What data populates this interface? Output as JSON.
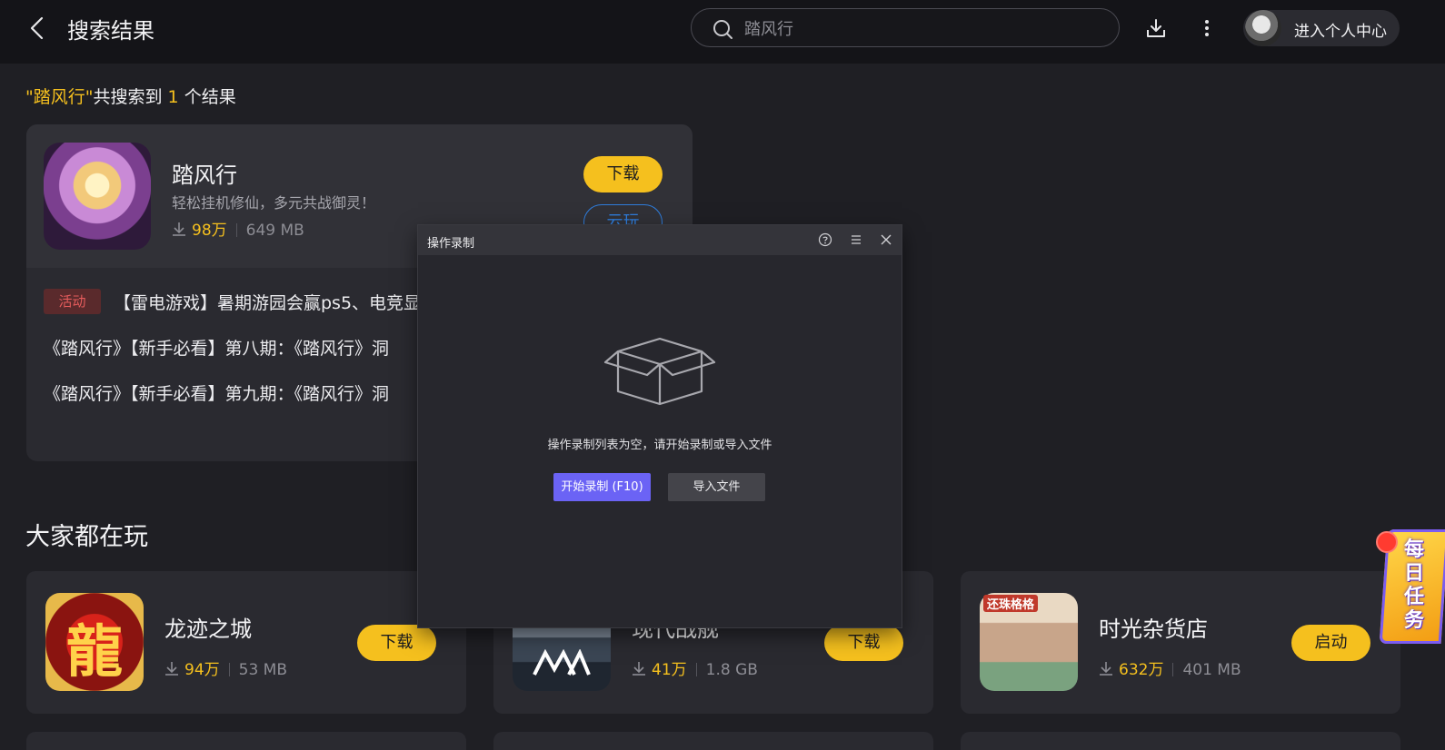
{
  "header": {
    "title": "搜索结果",
    "search_value": "踏风行",
    "user_label": "进入个人中心"
  },
  "result_summary": {
    "query_quoted": "\"踏风行\"",
    "middle": "共搜索到",
    "count": "1",
    "suffix": "个结果"
  },
  "main_result": {
    "name": "踏风行",
    "description": "轻松挂机修仙，多元共战御灵！",
    "downloads": "98万",
    "size": "649 MB",
    "download_label": "下载",
    "cloud_label": "云玩",
    "activity_tag": "活动",
    "news": [
      "【雷电游戏】暑期游园会赢ps5、电竞显",
      "《踏风行》【新手必看】第八期：《踏风行》洞",
      "《踏风行》【新手必看】第九期：《踏风行》洞"
    ]
  },
  "section_title": "大家都在玩",
  "popular": [
    {
      "name": "龙迹之城",
      "downloads": "94万",
      "size": "53 MB",
      "action": "下载",
      "icon_text": "龍"
    },
    {
      "name": "现代战舰",
      "downloads": "41万",
      "size": "1.8 GB",
      "action": "下载"
    },
    {
      "name": "时光杂货店",
      "downloads": "632万",
      "size": "401 MB",
      "action": "启动",
      "icon_text": "还珠格格"
    }
  ],
  "dialog": {
    "title": "操作录制",
    "empty_message": "操作录制列表为空，请开始录制或导入文件",
    "record_label": "开始录制 (F10)",
    "import_label": "导入文件"
  },
  "daily_task": {
    "label": "每日任务"
  },
  "colors": {
    "accent_yellow": "#f5c01e",
    "cloud_blue": "#2f7ddc",
    "record_purple": "#6b63f5",
    "activity_red": "#e65c5c"
  }
}
